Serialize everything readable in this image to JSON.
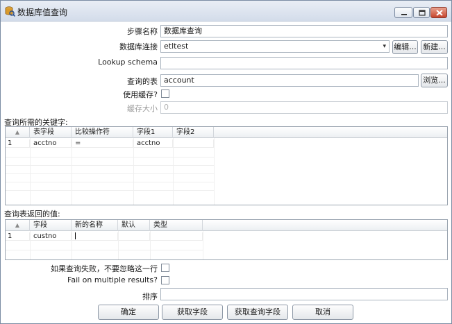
{
  "window": {
    "title": "数据库值查询"
  },
  "form": {
    "step_name_label": "步骤名称",
    "step_name_value": "数据库查询",
    "connection_label": "数据库连接",
    "connection_value": "etltest",
    "edit_button": "编辑...",
    "new_button": "新建...",
    "schema_label": "Lookup schema",
    "schema_value": "",
    "table_label": "查询的表",
    "table_value": "account",
    "browse_button": "浏览...",
    "cache_label": "使用缓存?",
    "cache_size_label": "缓存大小",
    "cache_size_value": "0"
  },
  "keys": {
    "section_label": "查询所需的关键字:",
    "columns": [
      "表字段",
      "比较操作符",
      "字段1",
      "字段2"
    ],
    "rows": [
      {
        "num": "1",
        "table_field": "acctno",
        "comparator": "=",
        "field1": "acctno",
        "field2": ""
      }
    ]
  },
  "returns": {
    "section_label": "查询表返回的值:",
    "columns": [
      "字段",
      "新的名称",
      "默认",
      "类型"
    ],
    "rows": [
      {
        "num": "1",
        "field": "custno",
        "new_name": "",
        "default": "",
        "type": ""
      }
    ]
  },
  "options": {
    "fail_label": "如果查询失败，不要忽略这一行",
    "multiple_label": "Fail on multiple results?",
    "order_label": "排序",
    "order_value": ""
  },
  "buttons": {
    "ok": "确定",
    "get_fields": "获取字段",
    "get_lookup_fields": "获取查询字段",
    "cancel": "取消"
  }
}
